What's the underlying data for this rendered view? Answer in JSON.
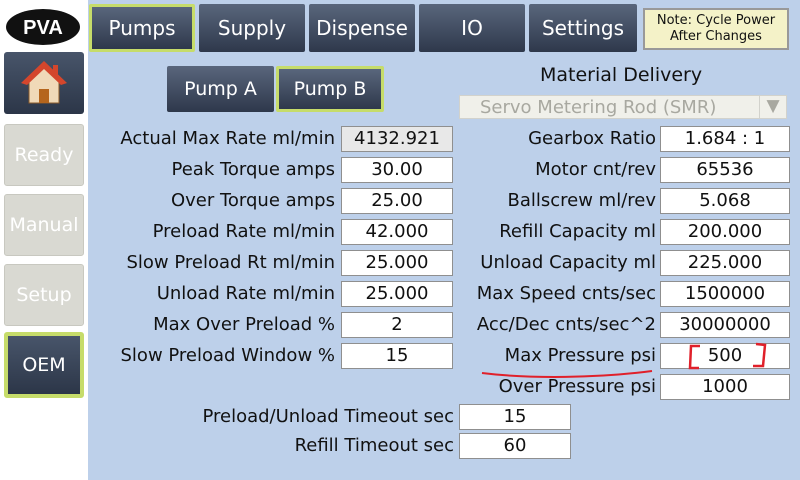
{
  "brand": {
    "logo_text": "PVA"
  },
  "sidebar": {
    "home_icon": "house-icon",
    "items": [
      {
        "label": "Ready"
      },
      {
        "label": "Manual"
      },
      {
        "label": "Setup"
      },
      {
        "label": "OEM"
      }
    ]
  },
  "tabs": [
    {
      "label": "Pumps"
    },
    {
      "label": "Supply"
    },
    {
      "label": "Dispense"
    },
    {
      "label": "IO"
    },
    {
      "label": "Settings"
    }
  ],
  "note": {
    "line1": "Note: Cycle Power",
    "line2": "After Changes"
  },
  "pump_selector": {
    "a": "Pump A",
    "b": "Pump B"
  },
  "material_delivery": {
    "title": "Material Delivery",
    "value": "Servo Metering Rod (SMR)"
  },
  "left_fields": [
    {
      "label": "Actual Max Rate ml/min",
      "value": "4132.921"
    },
    {
      "label": "Peak Torque amps",
      "value": "30.00"
    },
    {
      "label": "Over Torque amps",
      "value": "25.00"
    },
    {
      "label": "Preload Rate ml/min",
      "value": "42.000"
    },
    {
      "label": "Slow Preload Rt ml/min",
      "value": "25.000"
    },
    {
      "label": "Unload Rate ml/min",
      "value": "25.000"
    },
    {
      "label": "Max Over Preload %",
      "value": "2"
    },
    {
      "label": "Slow Preload Window %",
      "value": "15"
    }
  ],
  "right_fields": [
    {
      "label": "Gearbox Ratio",
      "value": "1.684 : 1"
    },
    {
      "label": "Motor cnt/rev",
      "value": "65536"
    },
    {
      "label": "Ballscrew ml/rev",
      "value": "5.068"
    },
    {
      "label": "Refill Capacity ml",
      "value": "200.000"
    },
    {
      "label": "Unload Capacity ml",
      "value": "225.000"
    },
    {
      "label": "Max Speed cnts/sec",
      "value": "1500000"
    },
    {
      "label": "Acc/Dec cnts/sec^2",
      "value": "30000000"
    },
    {
      "label": "Max Pressure psi",
      "value": "500"
    },
    {
      "label": "Over Pressure psi",
      "value": "1000"
    }
  ],
  "bottom_fields": [
    {
      "label": "Preload/Unload Timeout sec",
      "value": "15"
    },
    {
      "label": "Refill Timeout sec",
      "value": "60"
    }
  ],
  "colors": {
    "panel": "#bdd0ea",
    "accent": "#c6dc6a",
    "annotation": "#e0202a"
  }
}
